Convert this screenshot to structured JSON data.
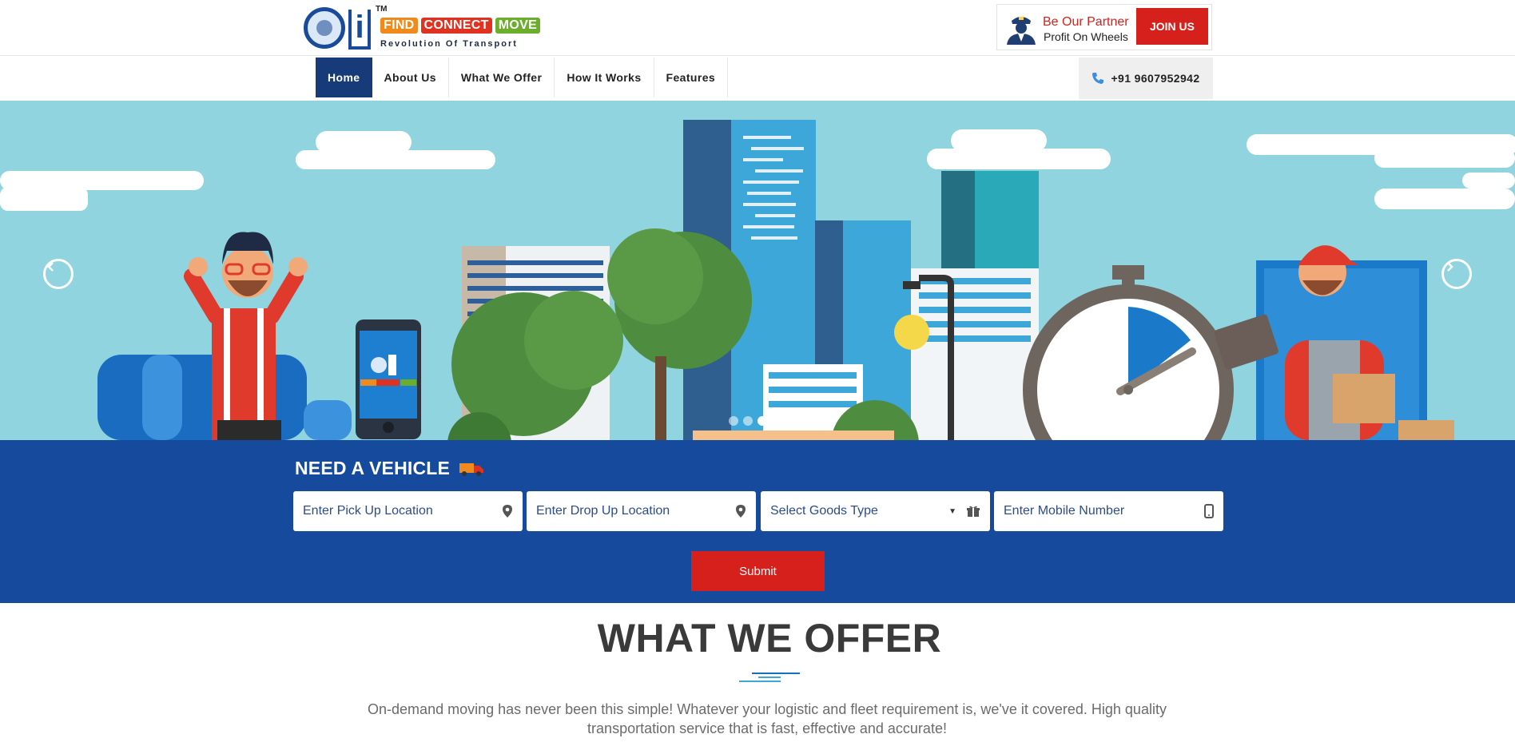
{
  "brand": {
    "logo_words": [
      "FIND",
      "CONNECT",
      "MOVE"
    ],
    "tm": "TM",
    "tagline": "Revolution Of Transport",
    "colors": {
      "navy": "#1a4b9a",
      "orange": "#f08a1d",
      "red": "#e03221",
      "green": "#6aae2b"
    }
  },
  "partner": {
    "icon": "driver-avatar-icon",
    "title": "Be Our Partner",
    "subtitle": "Profit On Wheels",
    "join_label": "JOIN US"
  },
  "nav": {
    "items": [
      {
        "label": "Home",
        "active": true
      },
      {
        "label": "About Us",
        "active": false
      },
      {
        "label": "What We Offer",
        "active": false
      },
      {
        "label": "How It Works",
        "active": false
      },
      {
        "label": "Features",
        "active": false
      }
    ],
    "phone_icon": "phone-icon",
    "phone": "+91 9607952942"
  },
  "hero": {
    "phone_screen_words": [
      "FIND",
      "CONNECT",
      "MOVE"
    ],
    "prev_icon": "chevron-left-icon",
    "next_icon": "chevron-right-icon",
    "slides_count": 4,
    "active_slide": 2
  },
  "booking": {
    "title": "NEED A VEHICLE",
    "title_icon": "truck-icon",
    "pickup_placeholder": "Enter Pick Up Location",
    "drop_placeholder": "Enter Drop Up Location",
    "goods_selected": "Select Goods Type",
    "mobile_placeholder": "Enter Mobile Number",
    "submit_label": "Submit"
  },
  "offer": {
    "title": "WHAT WE OFFER",
    "description": "On-demand moving has never been this simple! Whatever your logistic and fleet requirement is, we've it covered. High quality transportation service that is fast, effective and accurate!"
  },
  "colors": {
    "primary_blue": "#164a9c",
    "nav_active": "#173a78",
    "accent_red": "#d6201b",
    "sky": "#8fd4de"
  }
}
